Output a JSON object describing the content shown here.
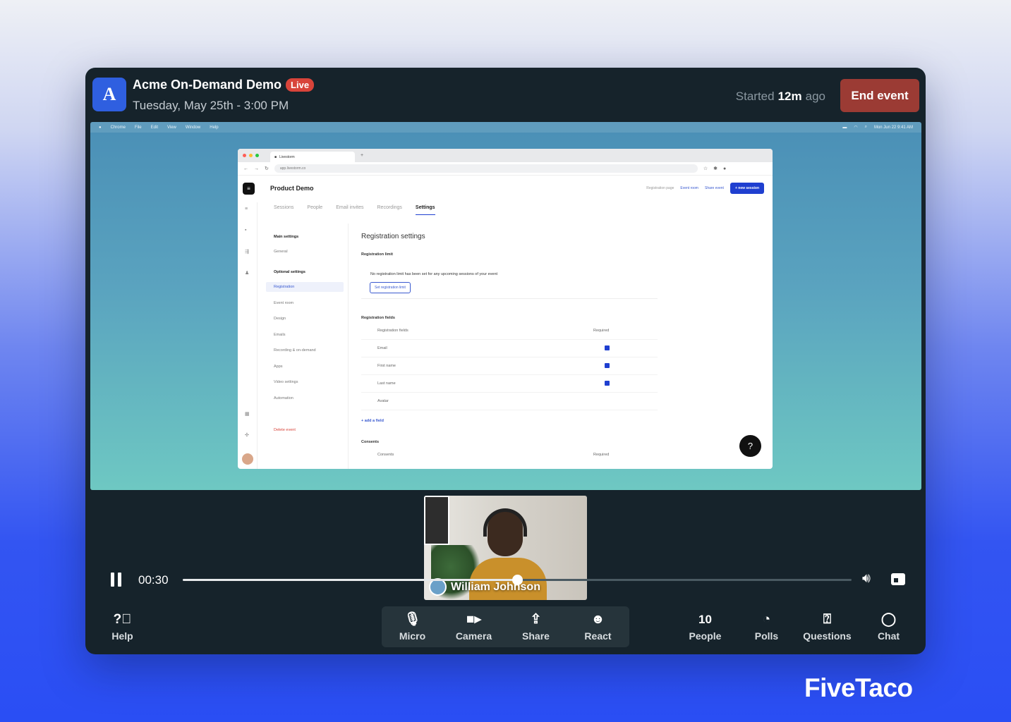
{
  "header": {
    "logo_letter": "A",
    "event_title": "Acme On-Demand Demo",
    "live_label": "Live",
    "event_date": "Tuesday, May 25th - 3:00 PM",
    "started_prefix": "Started",
    "started_value": "12m",
    "started_suffix": "ago",
    "end_button": "End event"
  },
  "shared_screen": {
    "mac_menu": [
      "Chrome",
      "File",
      "Edit",
      "View",
      "Window",
      "Help"
    ],
    "mac_clock": "Mon Jun 22  9:41 AM",
    "browser_tab": "Livestorm",
    "url": "app.livestorm.co",
    "app_title": "Product Demo",
    "app_actions": {
      "registration_page": "Registration page",
      "event_room": "Event room",
      "share_event": "Share event",
      "new_session": "+ new session"
    },
    "tabs": [
      "Sessions",
      "People",
      "Email invites",
      "Recordings",
      "Settings"
    ],
    "active_tab": "Settings",
    "settings_nav": {
      "main_heading": "Main settings",
      "general": "General",
      "optional_heading": "Optional settings",
      "items": [
        "Registration",
        "Event room",
        "Design",
        "Emails",
        "Recording & on-demand",
        "Apps",
        "Video settings",
        "Automation"
      ],
      "delete": "Delete event"
    },
    "content": {
      "title": "Registration settings",
      "limit_label": "Registration limit",
      "limit_note": "No registration limit has been set for any upcoming sessions of your event",
      "limit_button": "Set registration limit",
      "fields_label": "Registration fields",
      "fields_header": "Registration fields",
      "required_header": "Required",
      "fields": [
        {
          "name": "Email",
          "required": true
        },
        {
          "name": "First name",
          "required": true
        },
        {
          "name": "Last name",
          "required": true
        },
        {
          "name": "Avatar",
          "required": false
        }
      ],
      "add_field": "+ add a field",
      "consents_label": "Consents",
      "consents_header": "Consents",
      "consents_required": "Required"
    },
    "help_bubble": "?"
  },
  "camera": {
    "participant_name": "William Johnson"
  },
  "player": {
    "time": "00:30",
    "progress": 0.5
  },
  "controls": {
    "help": "Help",
    "micro": "Micro",
    "camera": "Camera",
    "share": "Share",
    "react": "React",
    "people_count": "10",
    "people": "People",
    "polls": "Polls",
    "questions": "Questions",
    "chat": "Chat"
  },
  "brand": "FiveTaco"
}
